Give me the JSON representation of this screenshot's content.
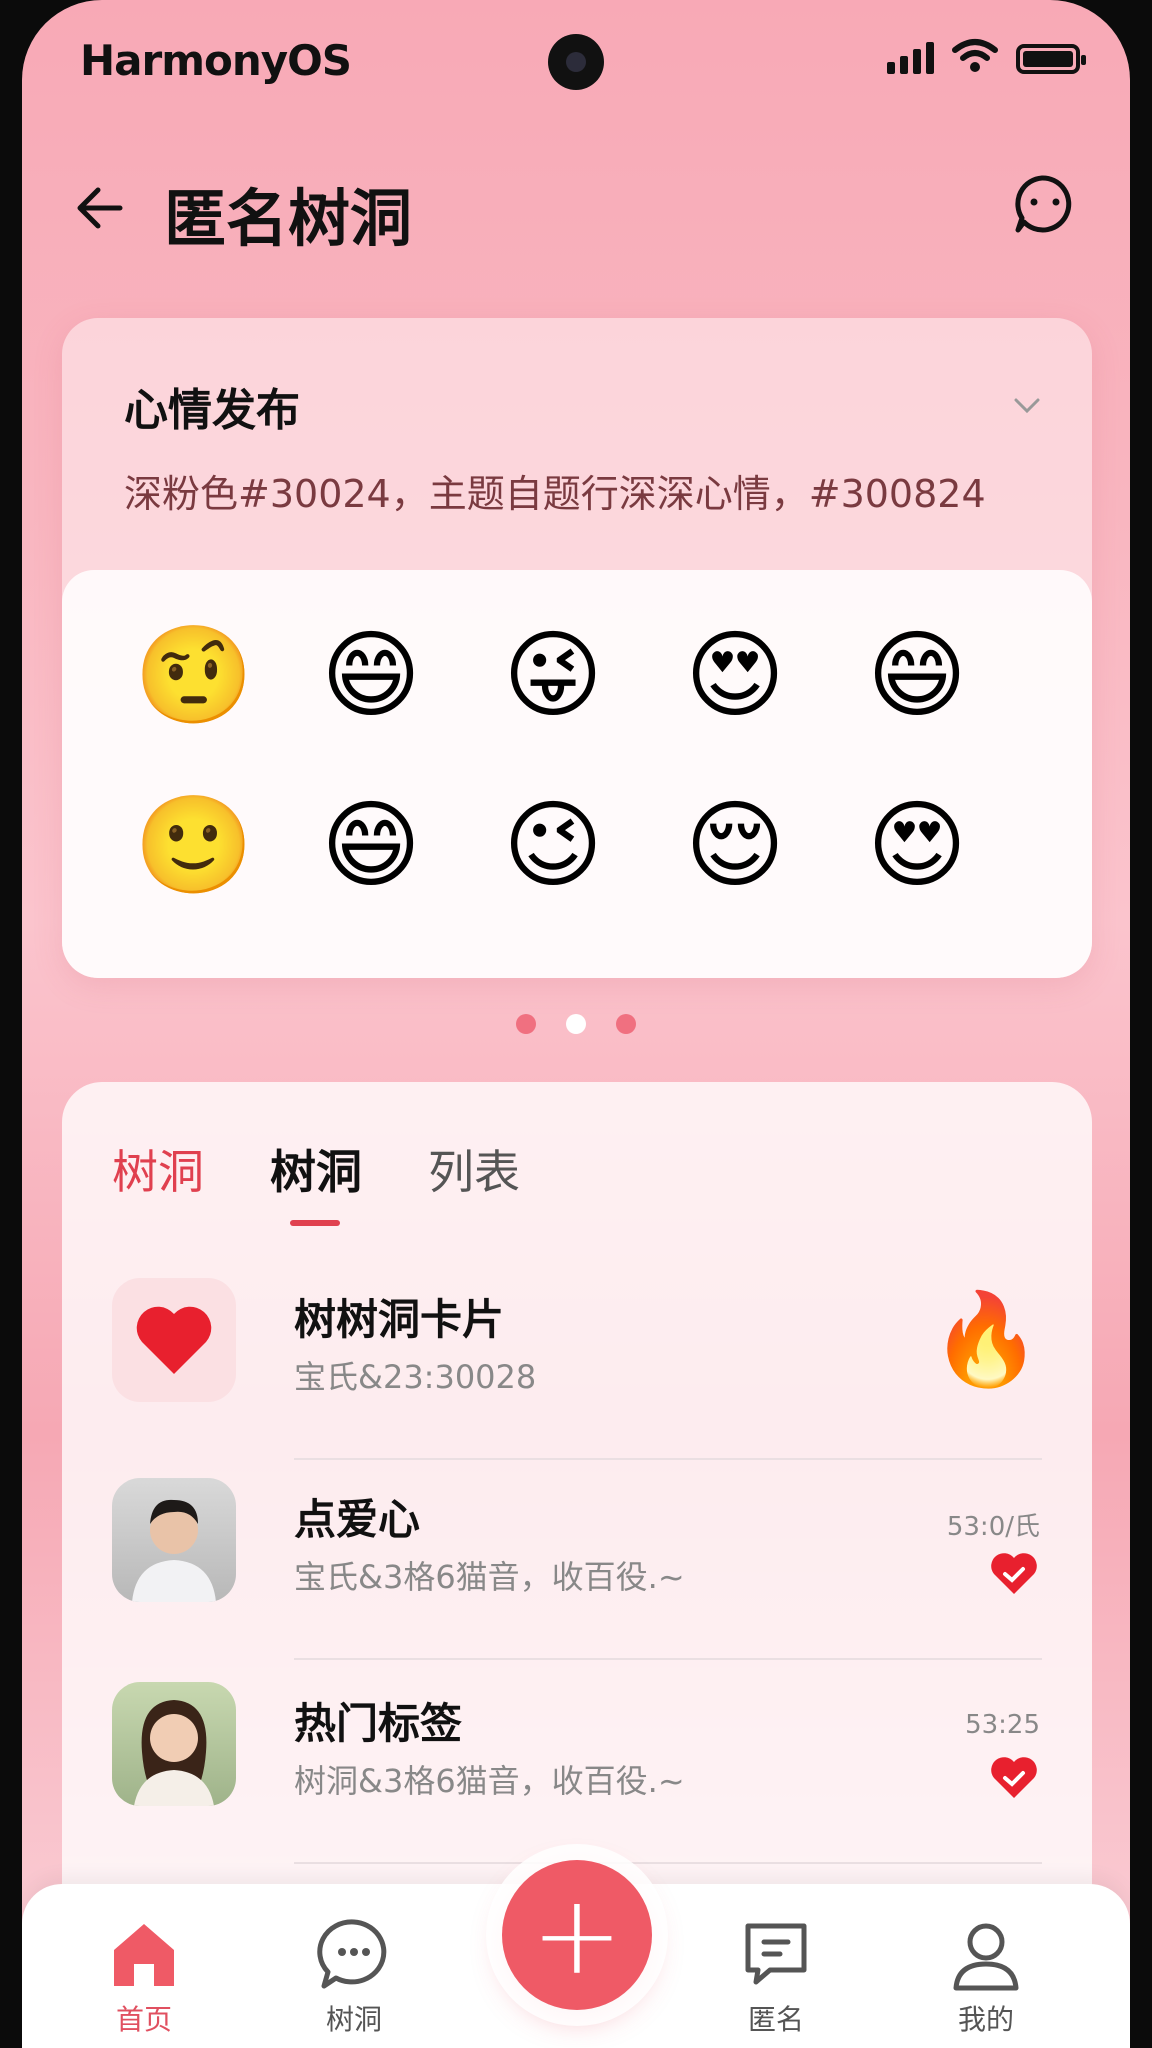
{
  "status_bar": {
    "brand": "HarmonyOS"
  },
  "header": {
    "title": "匿名树洞",
    "back_icon": "arrow-left-icon",
    "action_icon": "chat-bubble-icon"
  },
  "mood_card": {
    "title": "心情发布",
    "description": "深粉色#30024，主题自题行深深心情，#300824",
    "emojis": [
      "🤨",
      "😄",
      "😜",
      "😍",
      "😄",
      "🙂",
      "😄",
      "😉",
      "😌",
      "😍"
    ]
  },
  "pager": {
    "count": 3,
    "active_index": 1
  },
  "list_card": {
    "tabs": [
      {
        "label": "树洞"
      },
      {
        "label": "树洞"
      },
      {
        "label": "列表"
      }
    ],
    "rows": [
      {
        "title": "树树洞卡片",
        "subtitle": "宝氏&23:30028",
        "badge_icon": "fire-icon",
        "time": ""
      },
      {
        "title": "点爱心",
        "subtitle": "宝氏&3格6猫音，收百役.~",
        "time": "53:0/氏",
        "heart_icon": "heart-icon"
      },
      {
        "title": "热门标签",
        "subtitle": "树洞&3格6猫音，收百役.~",
        "time": "53:25",
        "heart_icon": "heart-icon"
      }
    ]
  },
  "bottom_nav": {
    "items": [
      {
        "label": "首页",
        "icon": "home-icon"
      },
      {
        "label": "树洞",
        "icon": "chat-icon"
      },
      {
        "label": "匿名",
        "icon": "message-square-icon"
      },
      {
        "label": "我的",
        "icon": "user-icon"
      }
    ],
    "fab_label": "+"
  },
  "colors": {
    "accent": "#e0404f",
    "fab": "#ef5a66",
    "background": "#f8a9b6"
  }
}
